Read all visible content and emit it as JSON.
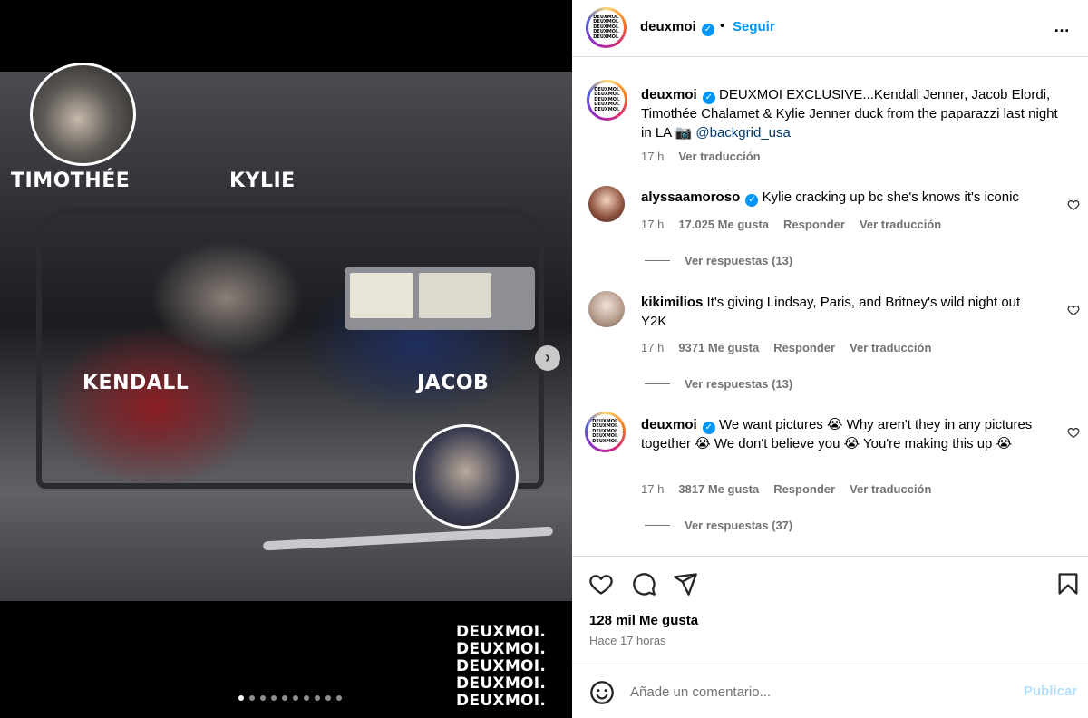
{
  "media": {
    "labels": {
      "timothee": "TIMOTHÉE",
      "kylie": "KYLIE",
      "kendall": "KENDALL",
      "jacob": "JACOB"
    },
    "stamp_lines": [
      "DEUXMOI.",
      "DEUXMOI.",
      "DEUXMOI.",
      "DEUXMOI.",
      "DEUXMOI."
    ],
    "carousel": {
      "total": 10,
      "active": 1
    },
    "next_icon": "chevron-right-icon"
  },
  "header": {
    "username": "deuxmoi",
    "verified": true,
    "separator": "•",
    "follow_label": "Seguir",
    "more_icon": "…"
  },
  "avatar_text": [
    "DEUXMOI.",
    "DEUXMOI.",
    "DEUXMOI.",
    "DEUXMOI.",
    "DEUXMOI."
  ],
  "caption": {
    "username": "deuxmoi",
    "text": "DEUXMOI EXCLUSIVE...Kendall Jenner, Jacob Elordi, Timothée Chalamet & Kylie Jenner duck from the paparazzi last night in LA 📷",
    "mention": "@backgrid_usa",
    "time": "17 h",
    "translate": "Ver traducción"
  },
  "comments": [
    {
      "username": "alyssaamoroso",
      "verified": true,
      "text": "Kylie cracking up bc she's knows it's iconic",
      "time": "17 h",
      "likes": "17.025 Me gusta",
      "reply": "Responder",
      "translate": "Ver traducción",
      "replies": "Ver respuestas (13)"
    },
    {
      "username": "kikimilios",
      "verified": false,
      "text": "It's giving Lindsay, Paris, and Britney's wild night out Y2K",
      "time": "17 h",
      "likes": "9371 Me gusta",
      "reply": "Responder",
      "translate": "Ver traducción",
      "replies": "Ver respuestas (13)"
    },
    {
      "username": "deuxmoi",
      "verified": true,
      "text": "We want pictures 😭 Why aren't they in any pictures together 😭 We don't believe you 😭 You're making this up 😭",
      "time": "17 h",
      "likes": "3817 Me gusta",
      "reply": "Responder",
      "translate": "Ver traducción",
      "replies": "Ver respuestas (37)"
    }
  ],
  "actions": {
    "like_icon": "heart-icon",
    "comment_icon": "comment-icon",
    "share_icon": "share-icon",
    "save_icon": "bookmark-icon"
  },
  "likes_total": "128 mil Me gusta",
  "posted_ago": "Hace 17 horas",
  "add_comment": {
    "placeholder": "Añade un comentario...",
    "publish_label": "Publicar",
    "emoji_icon": "emoji-icon"
  },
  "colors": {
    "link_blue": "#0095f6",
    "verified_blue": "#0095f6",
    "muted_text": "#737373",
    "publish_disabled": "#b2dffc"
  }
}
